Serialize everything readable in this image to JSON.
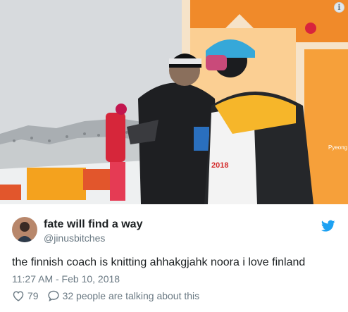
{
  "media": {
    "description_icon": "info-icon",
    "info_glyph": "i",
    "olympic_text": "2018",
    "banner_text": "Pyeong"
  },
  "tweet": {
    "author_name": "fate will find a way",
    "author_handle": "@jinusbitches",
    "text": "the finnish coach is knitting ahhakgjahk noora i love finland",
    "timestamp": "11:27 AM - Feb 10, 2018",
    "like_count": "79",
    "talking_text": "32 people are talking about this",
    "brand_icon": "twitter-bird-icon",
    "brand_color": "#1da1f2"
  }
}
